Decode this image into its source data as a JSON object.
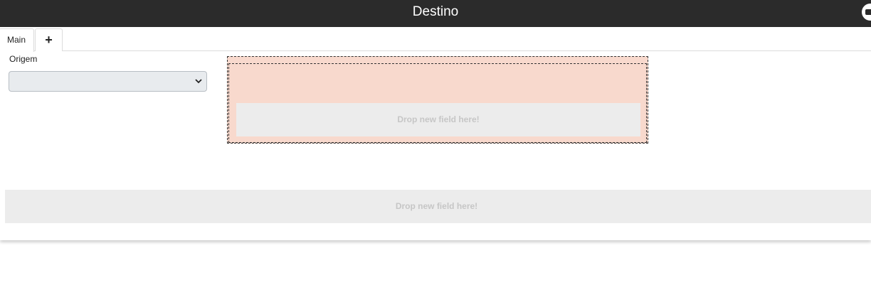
{
  "header": {
    "title": "Destino"
  },
  "tabs": [
    {
      "label": "Main"
    },
    {
      "label": "+"
    }
  ],
  "form": {
    "origem_label": "Origem",
    "origem_value": ""
  },
  "drop_zones": {
    "inner_text": "Drop new field here!",
    "bottom_text": "Drop new field here!"
  },
  "colors": {
    "topbar": "#2b2b2b",
    "drop_highlight": "#f8d9cd",
    "drop_field": "#ececec"
  },
  "icons": {
    "corner": "user-icon",
    "select": "chevron-down-icon"
  }
}
